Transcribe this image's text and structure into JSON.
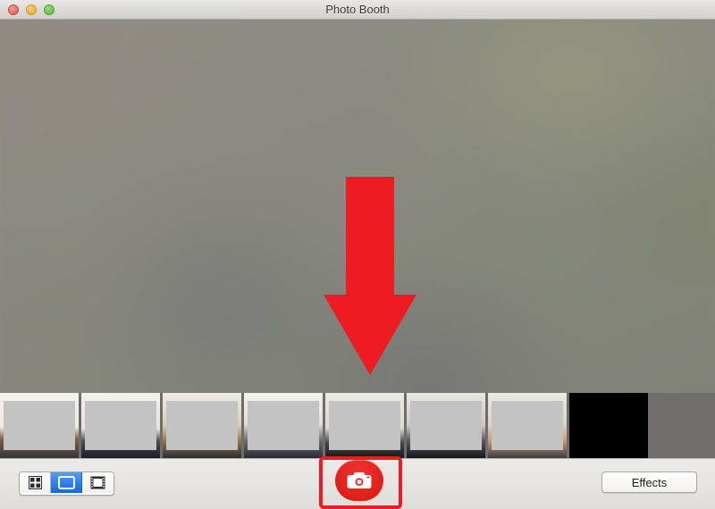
{
  "window": {
    "title": "Photo Booth",
    "controls": [
      {
        "name": "close",
        "color": "#e0564c"
      },
      {
        "name": "minimize",
        "color": "#e2a72f"
      },
      {
        "name": "maximize",
        "color": "#5bb63d"
      }
    ]
  },
  "preview": {
    "description": "Blurred live camera feed, gray-olive tones",
    "base_color": "#8a8580",
    "accent_color": "#96987c"
  },
  "annotations": {
    "arrow": {
      "name": "arrow-down-annotation",
      "color": "#ee1c22",
      "direction": "down",
      "points_to": "shutter-button"
    },
    "highlight_box": {
      "name": "shutter-highlight-box",
      "color": "#ee1c22",
      "target": "shutter-button"
    }
  },
  "thumbnails": [
    {
      "label": "thumbnail-1",
      "redacted": true,
      "background": "#b7b2a8"
    },
    {
      "label": "thumbnail-2",
      "redacted": true,
      "background": "#bdb8ae"
    },
    {
      "label": "thumbnail-3",
      "redacted": true,
      "background": "#b2aea6"
    },
    {
      "label": "thumbnail-4",
      "redacted": true,
      "background": "#b9b4aa"
    },
    {
      "label": "thumbnail-5",
      "redacted": true,
      "background": "#b6b2aa"
    },
    {
      "label": "thumbnail-6",
      "redacted": true,
      "background": "#aeaaa4"
    },
    {
      "label": "thumbnail-7",
      "redacted": true,
      "background": "#b4b0a8"
    },
    {
      "label": "thumbnail-8",
      "redacted": false,
      "background": "#000000"
    }
  ],
  "toolbar": {
    "modes": [
      {
        "id": "four-up",
        "icon": "grid-four-up-icon",
        "selected": false
      },
      {
        "id": "still-photo",
        "icon": "single-photo-icon",
        "selected": true
      },
      {
        "id": "movie",
        "icon": "film-strip-icon",
        "selected": false
      }
    ],
    "selected_mode": "still-photo",
    "shutter": {
      "label": "",
      "icon": "camera-icon",
      "color": "#e01f1c"
    },
    "effects_label": "Effects",
    "background_color": "#e9e8e5"
  }
}
